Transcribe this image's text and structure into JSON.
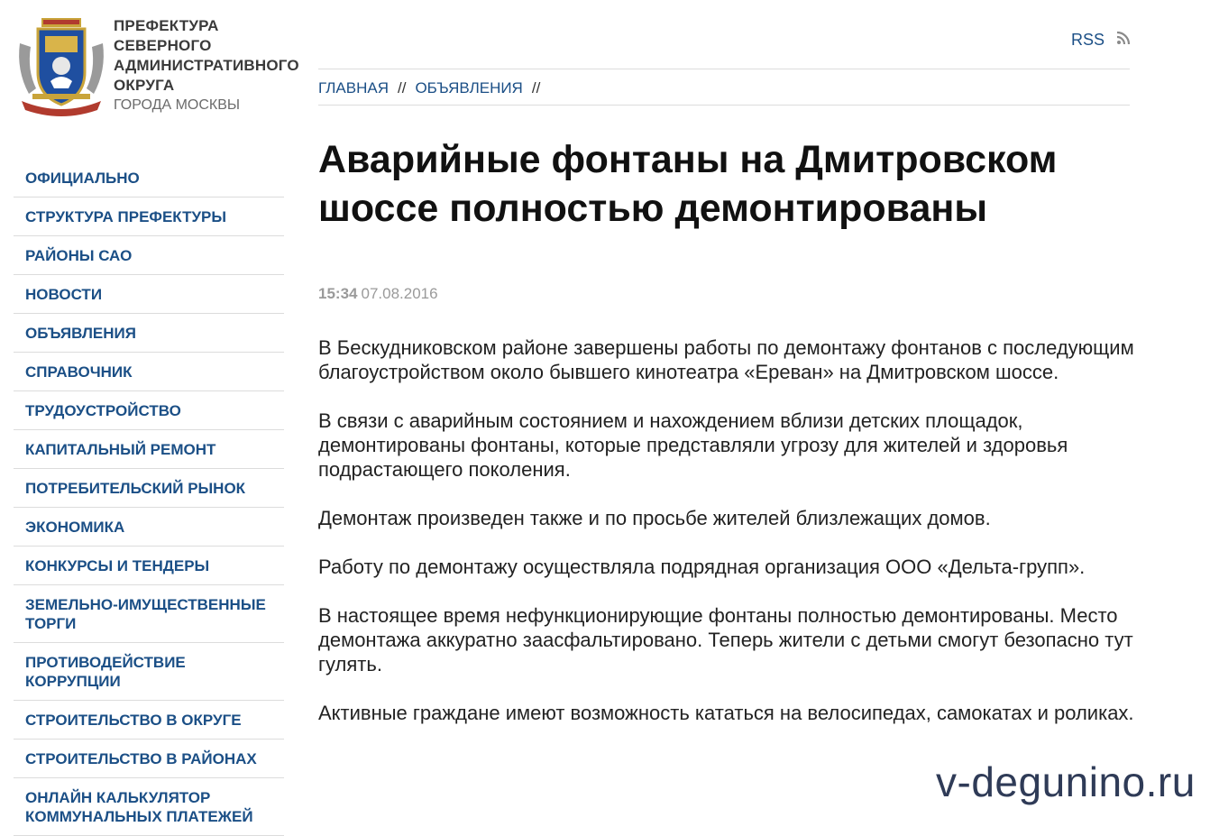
{
  "org": {
    "name_lines": [
      "ПРЕФЕКТУРА",
      "СЕВЕРНОГО",
      "АДМИНИСТРАТИВНОГО",
      "ОКРУГА"
    ],
    "subtitle": "ГОРОДА МОСКВЫ",
    "emblem_icon": "coat-of-arms-icon"
  },
  "header": {
    "rss_label": "RSS",
    "rss_icon": "rss-icon"
  },
  "breadcrumb": {
    "items": [
      "ГЛАВНАЯ",
      "ОБЪЯВЛЕНИЯ"
    ],
    "separator": "//"
  },
  "nav": {
    "items": [
      "ОФИЦИАЛЬНО",
      "СТРУКТУРА ПРЕФЕКТУРЫ",
      "РАЙОНЫ САО",
      "НОВОСТИ",
      "ОБЪЯВЛЕНИЯ",
      "СПРАВОЧНИК",
      "ТРУДОУСТРОЙСТВО",
      "КАПИТАЛЬНЫЙ РЕМОНТ",
      "ПОТРЕБИТЕЛЬСКИЙ РЫНОК",
      "ЭКОНОМИКА",
      "КОНКУРСЫ И ТЕНДЕРЫ",
      "ЗЕМЕЛЬНО-ИМУЩЕСТВЕННЫЕ ТОРГИ",
      "ПРОТИВОДЕЙСТВИЕ КОРРУПЦИИ",
      "СТРОИТЕЛЬСТВО В ОКРУГЕ",
      "СТРОИТЕЛЬСТВО В РАЙОНАХ",
      "ОНЛАЙН КАЛЬКУЛЯТОР КОММУНАЛЬНЫХ ПЛАТЕЖЕЙ"
    ]
  },
  "article": {
    "title": "Аварийные фонтаны на Дмитровском шоссе полностью демонтированы",
    "time": "15:34",
    "date": "07.08.2016",
    "paragraphs": [
      "В Бескудниковском районе завершены работы по демонтажу фонтанов с последующим благоустройством около бывшего кинотеатра «Ереван» на Дмитровском шоссе.",
      "В связи с аварийным состоянием и нахождением вблизи детских площадок, демонтированы фонтаны, которые представляли угрозу для жителей и здоровья подрастающего поколения.",
      "Демонтаж произведен также и по просьбе жителей близлежащих домов.",
      "Работу по демонтажу осуществляла подрядная организация ООО «Дельта-групп».",
      "В настоящее время нефункционирующие фонтаны полностью демонтированы. Место демонтажа аккуратно заасфальтировано. Теперь жители с детьми смогут безопасно тут гулять.",
      "Активные граждане имеют возможность кататься на велосипедах, самокатах и роликах."
    ]
  },
  "watermark": "v-degunino.ru",
  "colors": {
    "link": "#1b4f86",
    "muted": "#9a9a9a",
    "rule": "#dcdcdc"
  }
}
